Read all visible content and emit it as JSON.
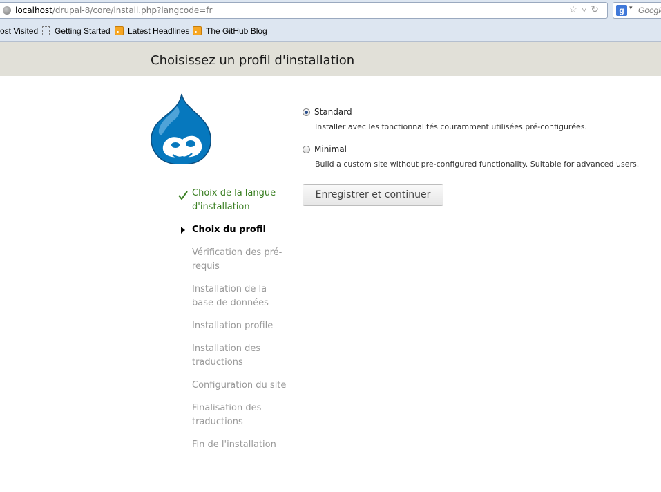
{
  "browser": {
    "url_host": "localhost",
    "url_path": "/drupal-8/core/install.php?langcode=fr",
    "search_placeholder": "Google",
    "bookmarks": [
      "ost Visited",
      "Getting Started",
      "Latest Headlines",
      "The GitHub Blog"
    ]
  },
  "page": {
    "title": "Choisissez un profil d'installation"
  },
  "steps": [
    {
      "label": "Choix de la langue d'installation",
      "state": "done"
    },
    {
      "label": "Choix du profil",
      "state": "active"
    },
    {
      "label": "Vérification des pré-requis",
      "state": "pending"
    },
    {
      "label": "Installation de la base de données",
      "state": "pending"
    },
    {
      "label": "Installation profile",
      "state": "pending"
    },
    {
      "label": "Installation des traductions",
      "state": "pending"
    },
    {
      "label": "Configuration du site",
      "state": "pending"
    },
    {
      "label": "Finalisation des traductions",
      "state": "pending"
    },
    {
      "label": "Fin de l'installation",
      "state": "pending"
    }
  ],
  "profiles": {
    "standard": {
      "label": "Standard",
      "description": "Installer avec les fonctionnalités couramment utilisées pré-configurées.",
      "checked": true
    },
    "minimal": {
      "label": "Minimal",
      "description": "Build a custom site without pre-configured functionality. Suitable for advanced users.",
      "checked": false
    }
  },
  "submit_label": "Enregistrer et continuer",
  "colors": {
    "header_bg": "#e1e0d8",
    "step_done": "#3a7f22",
    "step_pending": "#999999",
    "drupal_blue": "#0678be"
  }
}
